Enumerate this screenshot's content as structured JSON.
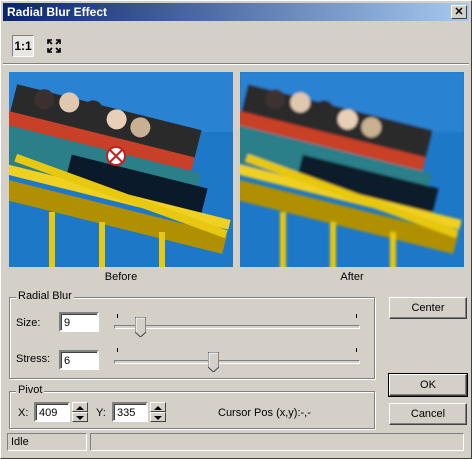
{
  "window": {
    "title": "Radial Blur Effect",
    "close_label": "✕"
  },
  "toolbar": {
    "actual_size_label": "1:1",
    "fit_icon": "fit-to-window-icon"
  },
  "previews": {
    "before_label": "Before",
    "after_label": "After"
  },
  "radial_blur": {
    "group_label": "Radial Blur",
    "size_label": "Size:",
    "size_value": "9",
    "stress_label": "Stress:",
    "stress_value": "6",
    "size_slider_fraction": 0.09,
    "stress_slider_fraction": 0.4
  },
  "pivot": {
    "group_label": "Pivot",
    "x_label": "X:",
    "x_value": "409",
    "y_label": "Y:",
    "y_value": "335",
    "cursor_label": "Cursor Pos (x,y):-,-"
  },
  "buttons": {
    "center_label": "Center",
    "ok_label": "OK",
    "cancel_label": "Cancel"
  },
  "status": {
    "text": "Idle",
    "secondary": ""
  },
  "colors": {
    "title_start": "#0a246a",
    "title_end": "#a6caf0",
    "face": "#d4d0c8",
    "sky": "#1e78c8"
  }
}
